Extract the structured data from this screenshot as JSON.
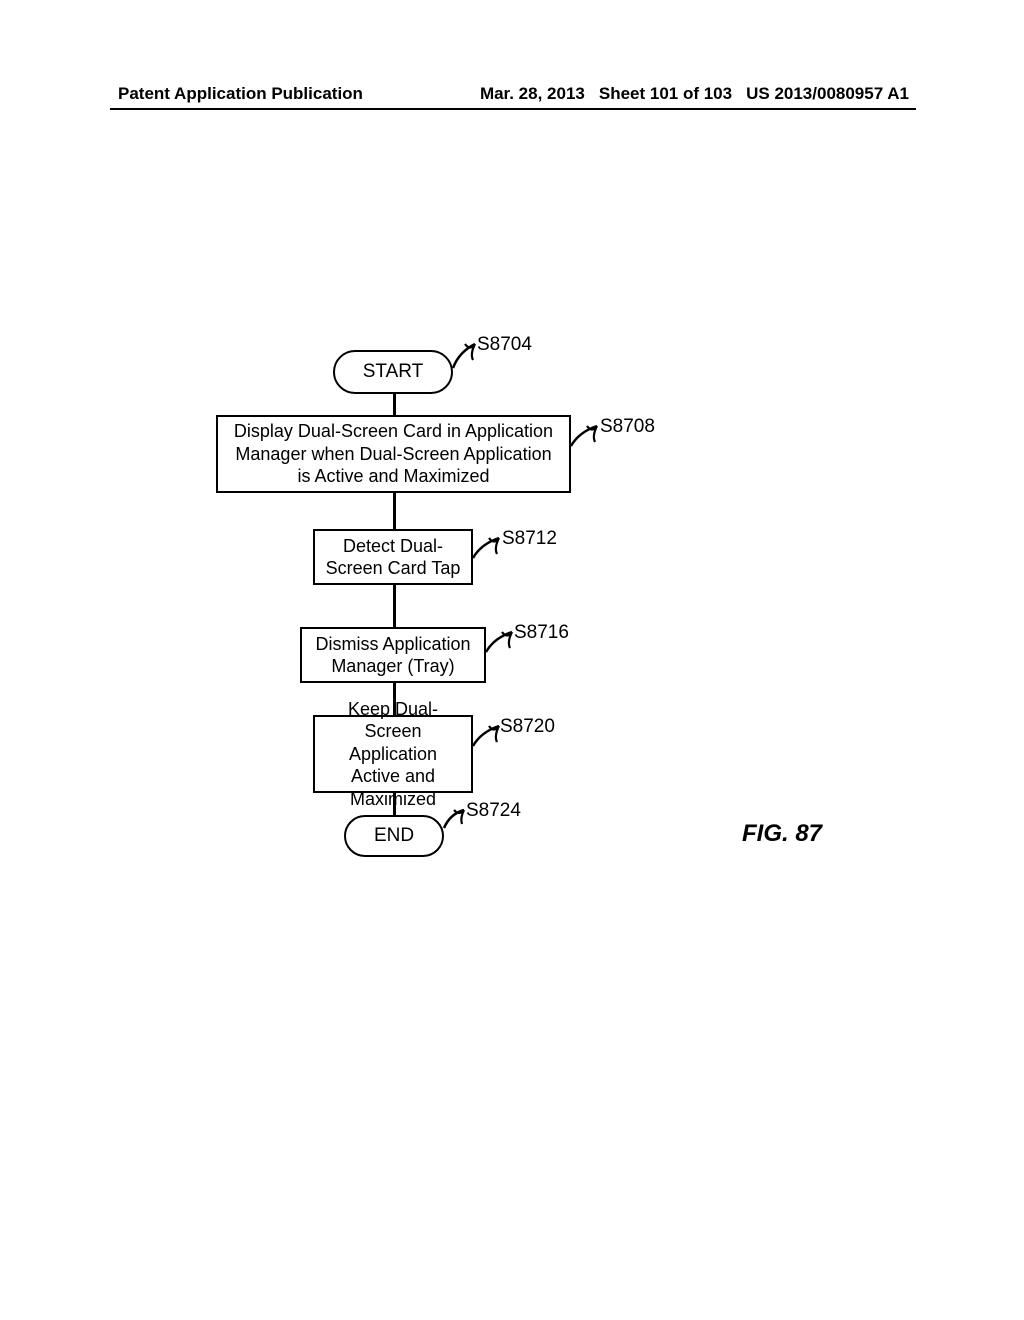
{
  "header": {
    "title": "Patent Application Publication",
    "date": "Mar. 28, 2013",
    "sheet": "Sheet 101 of 103",
    "pubnum": "US 2013/0080957 A1"
  },
  "figure_label": "FIG. 87",
  "flow": {
    "start": "START",
    "end": "END",
    "steps": [
      {
        "ref": "S8704",
        "text": ""
      },
      {
        "ref": "S8708",
        "text": "Display Dual-Screen Card in Application Manager when Dual-Screen Application is Active and Maximized"
      },
      {
        "ref": "S8712",
        "text": "Detect Dual-Screen Card Tap"
      },
      {
        "ref": "S8716",
        "text": "Dismiss Application Manager (Tray)"
      },
      {
        "ref": "S8720",
        "text": "Keep Dual-Screen Application Active and Maximized"
      },
      {
        "ref": "S8724",
        "text": ""
      }
    ]
  }
}
